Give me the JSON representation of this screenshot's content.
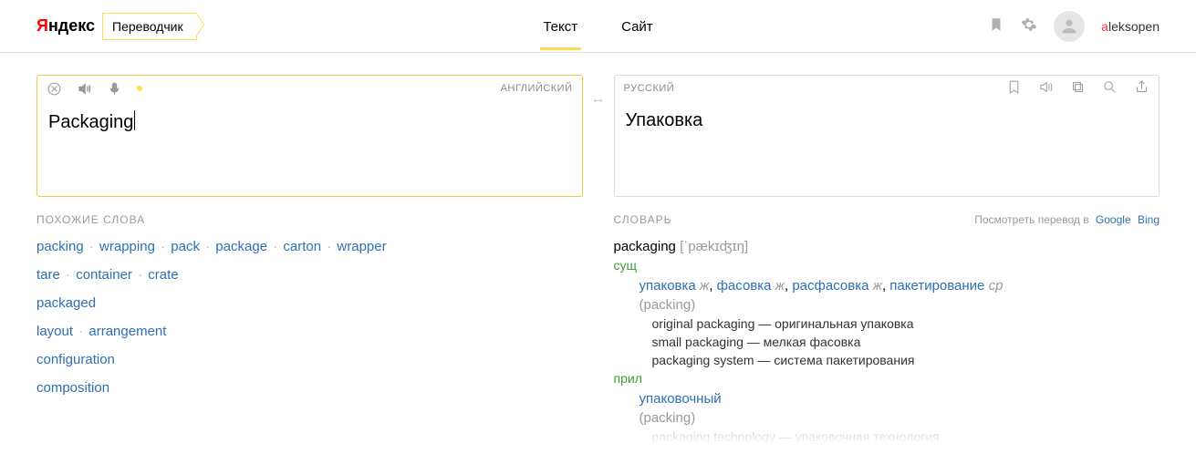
{
  "header": {
    "logo_prefix": "Я",
    "logo_rest": "ндекс",
    "service": "Переводчик",
    "nav": {
      "text": "Текст",
      "site": "Сайт"
    },
    "username_first": "a",
    "username_rest": "leksopen"
  },
  "source": {
    "lang": "АНГЛИЙСКИЙ",
    "text": "Packaging"
  },
  "target": {
    "lang": "РУССКИЙ",
    "text": "Упаковка"
  },
  "similar": {
    "title": "ПОХОЖИЕ СЛОВА",
    "rows": [
      [
        "packing",
        "wrapping",
        "pack",
        "package",
        "carton",
        "wrapper"
      ],
      [
        "tare",
        "container",
        "crate"
      ],
      [
        "packaged"
      ],
      [
        "layout",
        "arrangement"
      ],
      [
        "configuration"
      ],
      [
        "composition"
      ]
    ]
  },
  "dict": {
    "title": "СЛОВАРЬ",
    "lookup_label": "Посмотреть перевод в",
    "lookup_links": [
      "Google",
      "Bing"
    ],
    "headword": "packaging",
    "transcription": "[ˈpækɪʤɪŋ]",
    "pos1": "сущ",
    "meanings1": [
      {
        "w": "упаковка",
        "g": "ж"
      },
      {
        "w": "фасовка",
        "g": "ж"
      },
      {
        "w": "расфасовка",
        "g": "ж"
      },
      {
        "w": "пакетирование",
        "g": "ср"
      }
    ],
    "syn1": "(packing)",
    "examples1": [
      "original packaging — оригинальная упаковка",
      "small packaging — мелкая фасовка",
      "packaging system — система пакетирования"
    ],
    "pos2": "прил",
    "meanings2": [
      {
        "w": "упаковочный",
        "g": ""
      }
    ],
    "syn2": "(packing)",
    "examples2_cut": "packaging technology — упаковочная технология"
  }
}
